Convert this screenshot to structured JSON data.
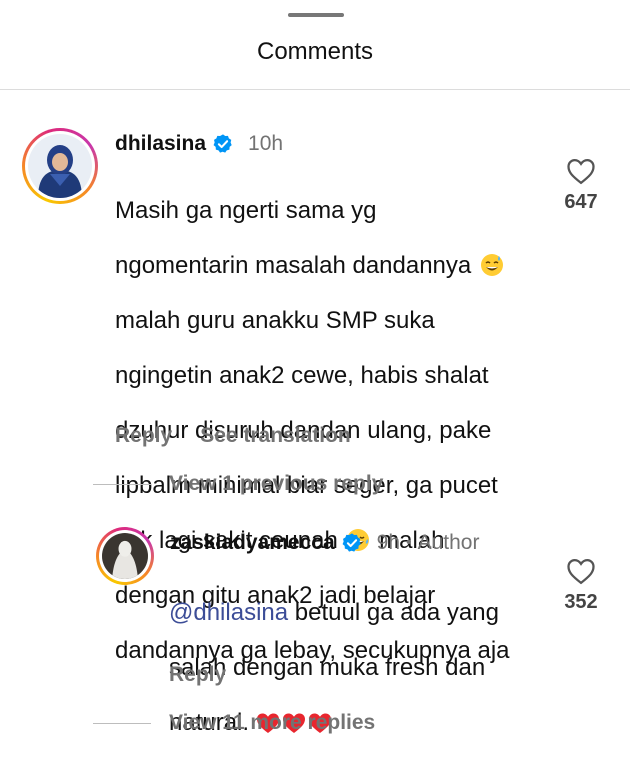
{
  "header": {
    "title": "Comments"
  },
  "comments": [
    {
      "username": "dhilasina",
      "time": "10h",
      "lines": [
        "Masih ga ngerti sama yg",
        "ngomentarin masalah dandannya",
        "malah guru anakku SMP suka",
        "ngingetin anak2 cewe, habis shalat",
        "dzuhur disuruh dandan ulang, pake",
        "lipbalm minimal biar seger, ga pucet",
        "kek lagi sakit ceunah",
        "malah",
        "dengan gitu anak2 jadi belajar",
        "dandannya ga lebay, secukupnya aja"
      ],
      "emoji_sweat": "sweat-smile-emoji",
      "emoji_laugh": "tears-of-joy-emoji",
      "reply_label": "Reply",
      "translate_label": "See translation",
      "likes": "647"
    }
  ],
  "view_previous": "View 1 previous reply",
  "reply": {
    "username": "zaskiadyamecca",
    "time": "9h",
    "author_label": "Author",
    "mention": "@dhilasina",
    "line1_rest": "betuul ga ada yang",
    "line2": "salah dengan muka fresh dan",
    "line3": "natural.",
    "hearts": "red-heart-emoji",
    "reply_label": "Reply",
    "likes": "352"
  },
  "view_more": "View 11 more replies",
  "colors": {
    "verified": "#0095f6",
    "mention": "#3c4d97",
    "muted": "#737373"
  }
}
